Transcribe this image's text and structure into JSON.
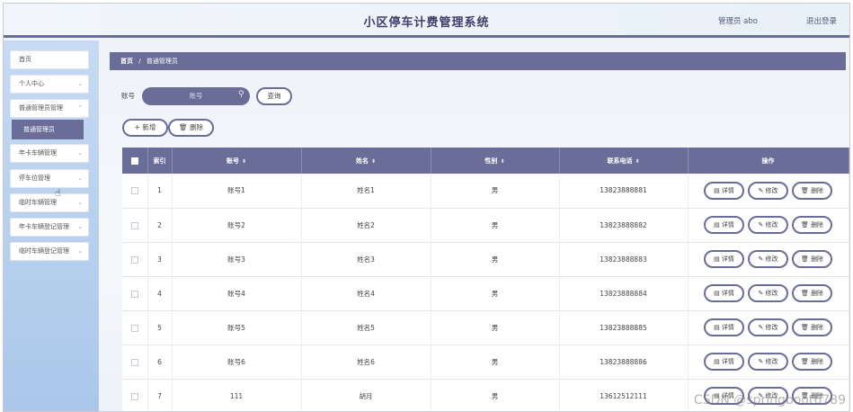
{
  "header": {
    "title": "小区停车计费管理系统",
    "user": "管理员 abo",
    "logout": "退出登录"
  },
  "sidebar": {
    "items": [
      {
        "label": "首页"
      },
      {
        "label": "个人中心"
      },
      {
        "label": "普通管理员管理"
      },
      {
        "label": "普通管理员"
      },
      {
        "label": "年卡车辆管理"
      },
      {
        "label": "停车位管理"
      },
      {
        "label": "临时车辆管理"
      },
      {
        "label": "年卡车辆登记管理"
      },
      {
        "label": "临时车辆登记管理"
      }
    ]
  },
  "breadcrumb": {
    "home": "首页",
    "sep": "/",
    "current": "普通管理员"
  },
  "search": {
    "label": "账号",
    "placeholder": "账号",
    "button": "查询"
  },
  "actions": {
    "add": "+ 新增",
    "delete": "删除"
  },
  "table": {
    "columns": [
      "索引",
      "账号",
      "姓名",
      "性别",
      "联系电话",
      "操作"
    ],
    "row_actions": {
      "detail": "详情",
      "edit": "修改",
      "delete": "删除"
    },
    "rows": [
      {
        "index": "1",
        "account": "账号1",
        "name": "姓名1",
        "gender": "男",
        "phone": "13823888881"
      },
      {
        "index": "2",
        "account": "账号2",
        "name": "姓名2",
        "gender": "男",
        "phone": "13823888882"
      },
      {
        "index": "3",
        "account": "账号3",
        "name": "姓名3",
        "gender": "男",
        "phone": "13823888883"
      },
      {
        "index": "4",
        "account": "账号4",
        "name": "姓名4",
        "gender": "男",
        "phone": "13823888884"
      },
      {
        "index": "5",
        "account": "账号5",
        "name": "姓名5",
        "gender": "男",
        "phone": "13823888885"
      },
      {
        "index": "6",
        "account": "账号6",
        "name": "姓名6",
        "gender": "男",
        "phone": "13823888886"
      },
      {
        "index": "7",
        "account": "111",
        "name": "胡月",
        "gender": "男",
        "phone": "13612512111"
      }
    ]
  },
  "watermark": "CSDN @springboot6789",
  "colors": {
    "accent": "#6b6d99",
    "sidebar": "#aac7ea"
  }
}
